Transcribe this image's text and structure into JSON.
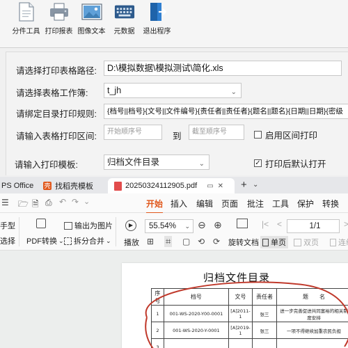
{
  "toolbar": {
    "buttons": [
      {
        "label": "分件工具",
        "icon": "document-icon"
      },
      {
        "label": "打印报表",
        "icon": "printer-icon"
      },
      {
        "label": "图像文本",
        "icon": "image-icon"
      },
      {
        "label": "元数据",
        "icon": "keyboard-icon"
      },
      {
        "label": "退出程序",
        "icon": "exit-icon"
      }
    ]
  },
  "form": {
    "path_label": "请选择打印表格路径:",
    "path_value": "D:\\模拟数据\\模拟测试\\简化.xls",
    "sheet_label": "请选择表格工作簿:",
    "sheet_value": "t_jh",
    "rule_label": "请绑定目录打印规则:",
    "rule_value": "{档号||档号}{文号||文件编号}{责任者||责任者}{题名||题名}{日期||日期}{密级",
    "range_label": "请输入表格打印区间:",
    "range_start_placeholder": "开始顺序号",
    "range_to": "到",
    "range_end_placeholder": "截至顺序号",
    "range_enable_label": "启用区间打印",
    "range_enable_checked": false,
    "template_label": "请输入打印模板:",
    "template_value": "归档文件目录",
    "open_after_print_label": "打印后默认打开",
    "open_after_print_checked": true
  },
  "wps": {
    "tabs": [
      {
        "label": "PS Office"
      },
      {
        "label": "找稻壳模板"
      },
      {
        "label": "20250324112905.pdf",
        "active": true
      }
    ],
    "quick_tools": [
      "☰",
      "🗁",
      "🗎",
      "⎙",
      "↶",
      "↷",
      "⌄"
    ],
    "menu": [
      "开始",
      "插入",
      "编辑",
      "页面",
      "批注",
      "工具",
      "保护",
      "转换"
    ],
    "ribbon": {
      "hand_tool": "手型",
      "select_tool": "选择",
      "pdf_convert": "PDF转换",
      "export_image": "输出为图片",
      "split_merge": "拆分合并",
      "play": "播放",
      "zoom": "55.54%",
      "page": "1/1",
      "rotate": "旋转文档",
      "single_page": "单页",
      "double_page": "双页",
      "continuous": "连续"
    },
    "document": {
      "title": "归档文件目录",
      "headers": [
        "序号",
        "档号",
        "文号",
        "责任者",
        "题　　名"
      ],
      "rows": [
        {
          "no": "1",
          "code": "001-WS-2020-Y00-0001",
          "doc_no": "[A]2011-1",
          "owner": "张三",
          "title": "进一步完善促进共同富裕的相关制度安排"
        },
        {
          "no": "2",
          "code": "001-WS-2020-Y-0001",
          "doc_no": "[A]2019-1",
          "owner": "张三",
          "title": "一项不得继续加重农民负担"
        },
        {
          "no": "3",
          "code": "",
          "doc_no": "",
          "owner": "",
          "title": ""
        }
      ]
    }
  },
  "colors": {
    "accent": "#e0571b",
    "annotation_red": "#c0392b"
  }
}
